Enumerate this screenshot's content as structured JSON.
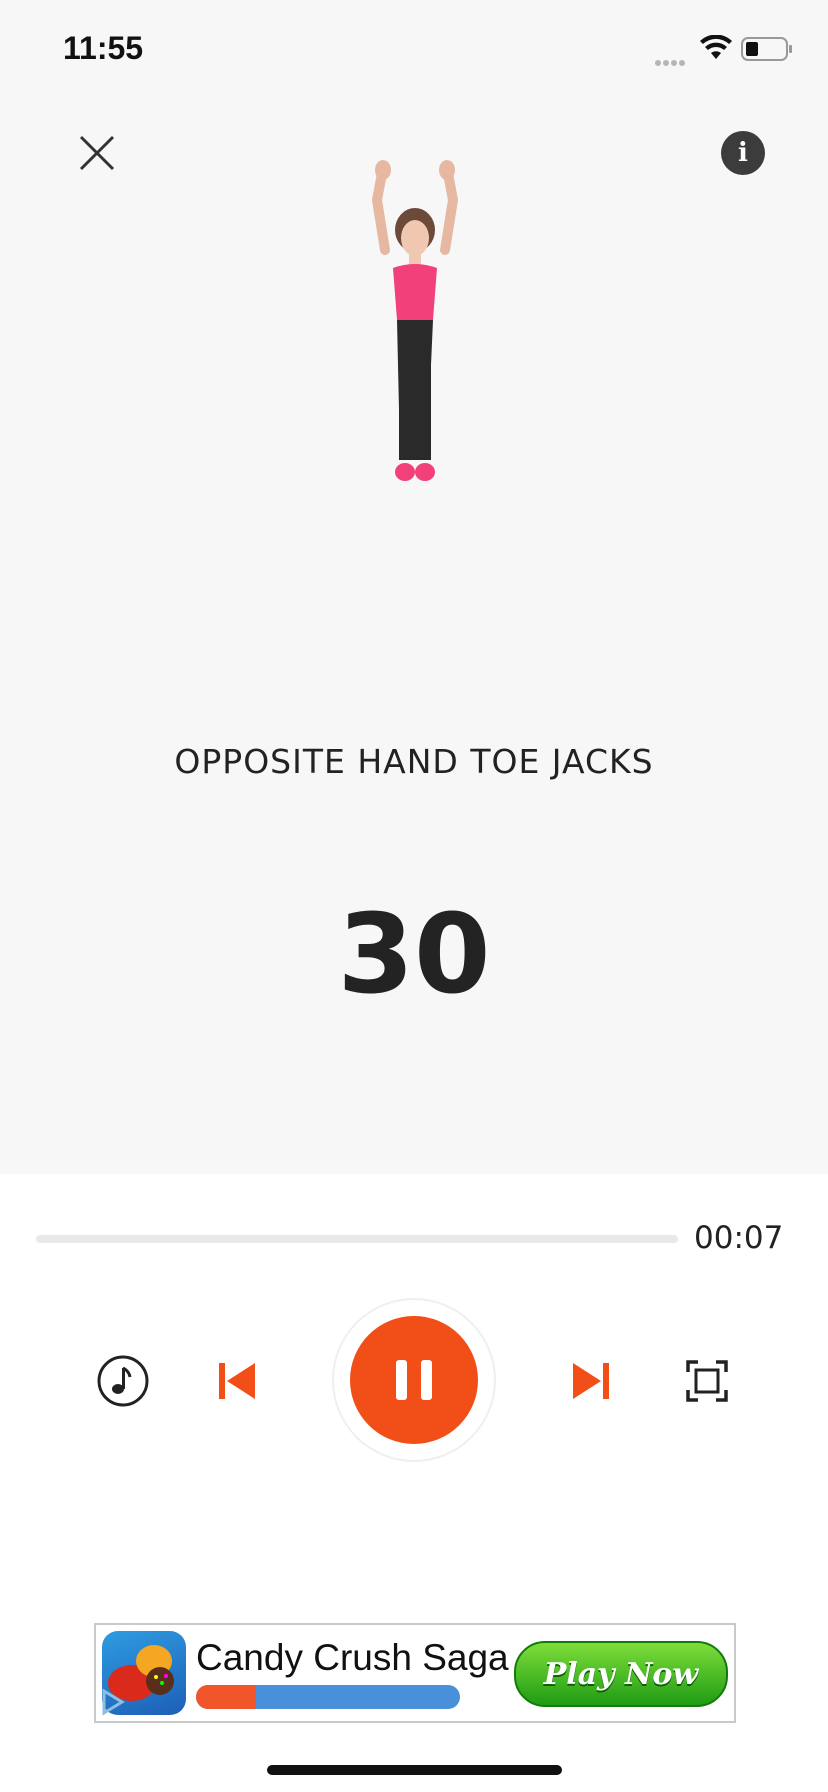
{
  "status_bar": {
    "time": "11:55",
    "icons": [
      "signal-icon",
      "wifi-icon",
      "battery-icon"
    ]
  },
  "header": {
    "close_icon": "close-icon",
    "info_icon": "info-icon",
    "info_glyph": "i"
  },
  "exercise": {
    "name": "OPPOSITE HAND TOE JACKS",
    "count": "30"
  },
  "progress": {
    "elapsed": "00:07",
    "fraction": 0.0
  },
  "controls": {
    "music_icon": "music-note-icon",
    "prev_icon": "skip-previous-icon",
    "pause_icon": "pause-icon",
    "next_icon": "skip-next-icon",
    "fullscreen_icon": "fullscreen-icon"
  },
  "ad": {
    "title": "Candy Crush Saga",
    "cta": "Play Now"
  },
  "colors": {
    "accent": "#f24e17",
    "background": "#f7f7f7",
    "text": "#222222"
  }
}
